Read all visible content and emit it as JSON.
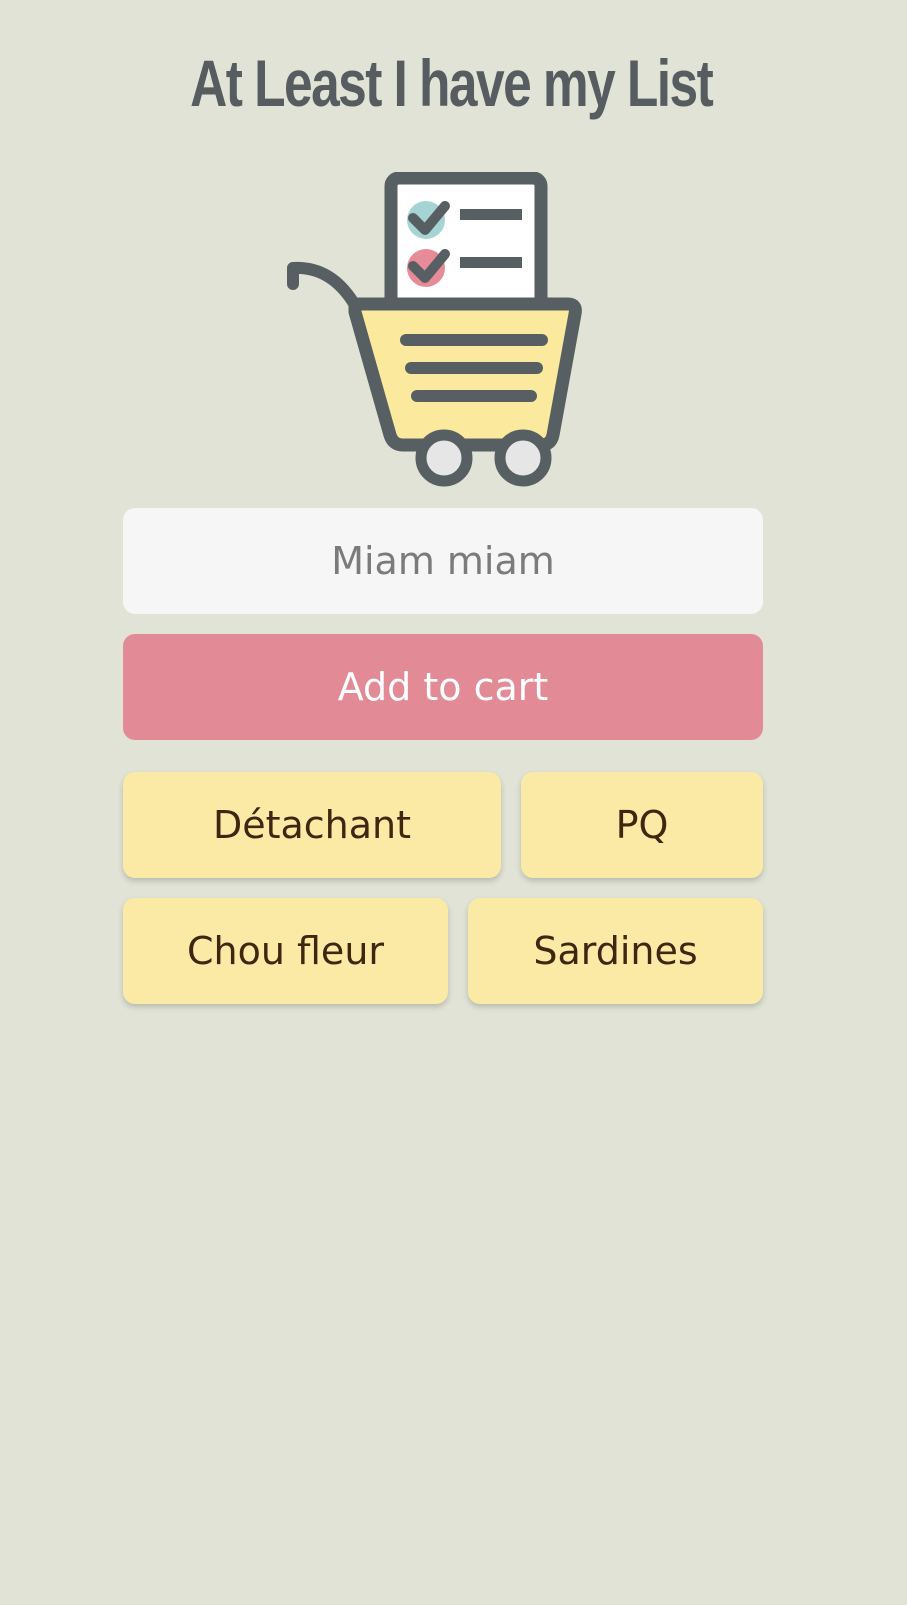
{
  "app": {
    "title": "At Least I have my List",
    "logo_icon": "shopping-cart-checklist-icon"
  },
  "form": {
    "input_placeholder": "Miam miam",
    "input_value": "",
    "add_button_label": "Add to cart"
  },
  "items": [
    {
      "label": "Détachant"
    },
    {
      "label": "PQ"
    },
    {
      "label": "Chou fleur"
    },
    {
      "label": "Sardines"
    }
  ],
  "colors": {
    "background": "#e0e3d6",
    "title": "#565c5f",
    "input_bg": "#f6f6f6",
    "button_bg": "#e28b97",
    "item_bg": "#fbeaa6",
    "item_text": "#3e2610"
  }
}
